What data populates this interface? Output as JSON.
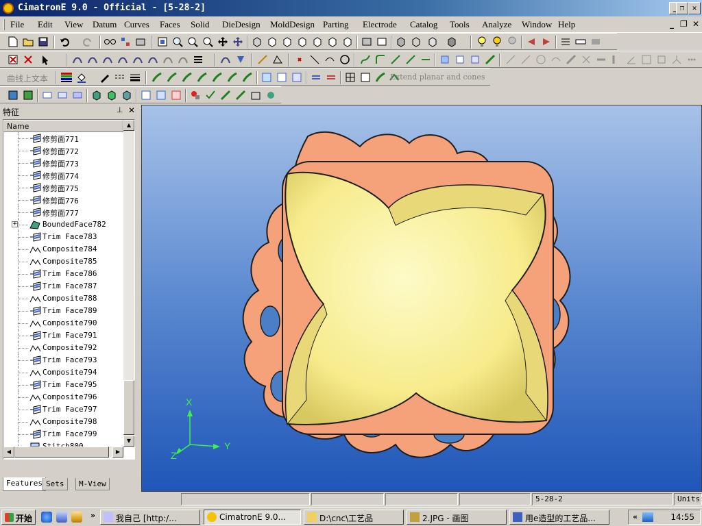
{
  "window": {
    "title": "CimatronE 9.0 - Official - [5-28-2]",
    "minimize": "_",
    "restore": "❐",
    "close": "✕"
  },
  "menu": {
    "items": [
      "File",
      "Edit",
      "View",
      "Datum",
      "Curves",
      "Faces",
      "Solid",
      "DieDesign",
      "MoldDesign",
      "Parting",
      "Electrode",
      "Catalog",
      "Tools",
      "Analyze",
      "Window",
      "Help"
    ],
    "mdi_min": "_",
    "mdi_restore": "❐",
    "mdi_close": "✕"
  },
  "toolbar3": {
    "chinese_label": "曲线上文本",
    "extend_label": "Extend planar and cones"
  },
  "panel": {
    "title": "特征",
    "pin": "⊥",
    "close": "✕",
    "column_header": "Name",
    "rows": [
      {
        "label": "修剪面771",
        "icon": "trim"
      },
      {
        "label": "修剪面772",
        "icon": "trim"
      },
      {
        "label": "修剪面773",
        "icon": "trim"
      },
      {
        "label": "修剪面774",
        "icon": "trim"
      },
      {
        "label": "修剪面775",
        "icon": "trim"
      },
      {
        "label": "修剪面776",
        "icon": "trim"
      },
      {
        "label": "修剪面777",
        "icon": "trim"
      },
      {
        "label": "BoundedFace782",
        "icon": "bounded",
        "expand": "+"
      },
      {
        "label": "Trim Face783",
        "icon": "trim"
      },
      {
        "label": "Composite784",
        "icon": "composite"
      },
      {
        "label": "Composite785",
        "icon": "composite"
      },
      {
        "label": "Trim Face786",
        "icon": "trim"
      },
      {
        "label": "Trim Face787",
        "icon": "trim"
      },
      {
        "label": "Composite788",
        "icon": "composite"
      },
      {
        "label": "Trim Face789",
        "icon": "trim"
      },
      {
        "label": "Composite790",
        "icon": "composite"
      },
      {
        "label": "Trim Face791",
        "icon": "trim"
      },
      {
        "label": "Composite792",
        "icon": "composite"
      },
      {
        "label": "Trim Face793",
        "icon": "trim"
      },
      {
        "label": "Composite794",
        "icon": "composite"
      },
      {
        "label": "Trim Face795",
        "icon": "trim"
      },
      {
        "label": "Composite796",
        "icon": "composite"
      },
      {
        "label": "Trim Face797",
        "icon": "trim"
      },
      {
        "label": "Composite798",
        "icon": "composite"
      },
      {
        "label": "Trim Face799",
        "icon": "trim"
      },
      {
        "label": "Stitch800",
        "icon": "stitch"
      }
    ],
    "tabs": [
      "Features",
      "Sets",
      "M-View"
    ],
    "active_tab": "Features"
  },
  "viewport": {
    "axis_x": "X",
    "axis_y": "Y",
    "axis_z": "Z",
    "colors": {
      "ring": "#f7a77c",
      "inner": "#f9f3a0",
      "background_top": "#a7c2e8",
      "background_bottom": "#1f56b8",
      "axis": "#3df04a"
    }
  },
  "status": {
    "file": "5-28-2",
    "units": "Units:"
  },
  "taskbar": {
    "start": "开始",
    "tasks": [
      {
        "label": "我自己 [http:/...",
        "active": false
      },
      {
        "label": "CimatronE 9.0...",
        "active": true
      },
      {
        "label": "D:\\cnc\\工艺品",
        "active": false
      },
      {
        "label": "2.JPG - 画图",
        "active": false
      },
      {
        "label": "用e造型的工艺品...",
        "active": false
      }
    ],
    "more": "»",
    "tray_expand": "«",
    "clock": "14:55"
  }
}
